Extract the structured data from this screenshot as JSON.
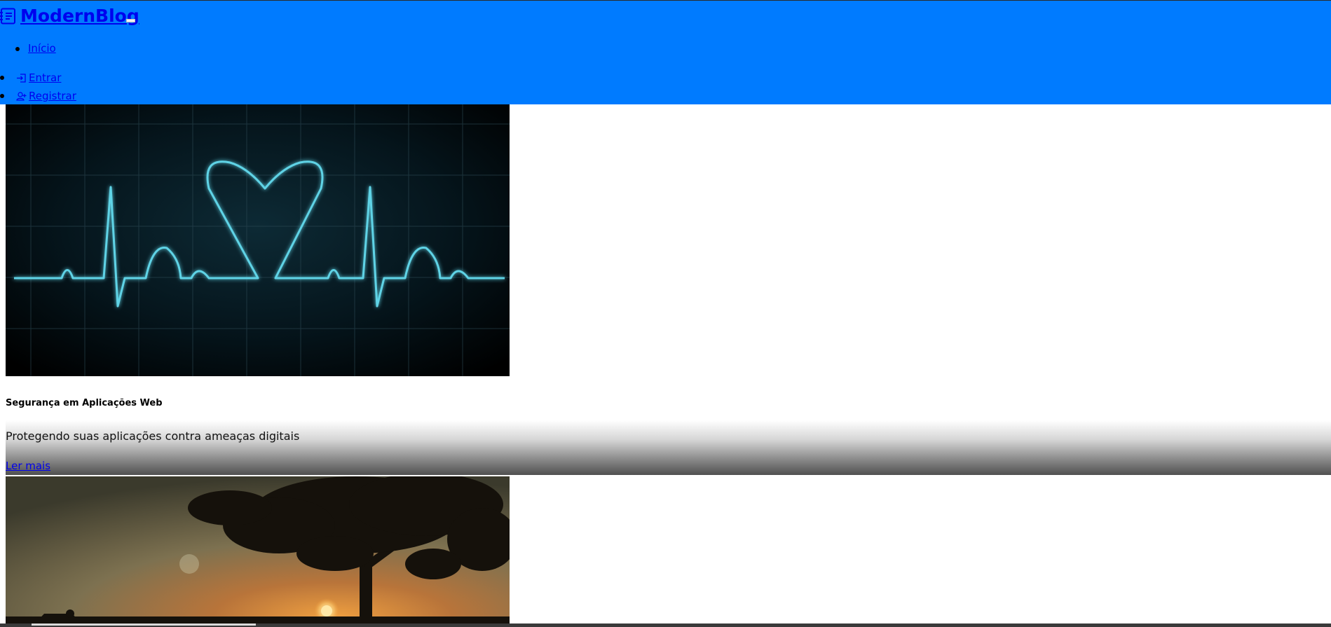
{
  "header": {
    "brand": "ModernBlog",
    "brand_icon": "journal-text-icon",
    "bg_color": "#007bff",
    "nav_items": [
      {
        "label": "Início",
        "icon": ""
      },
      {
        "label": "Entrar",
        "icon": "box-arrow-in-right-icon"
      },
      {
        "label": "Registrar",
        "icon": "person-plus-icon"
      }
    ]
  },
  "posts": [
    {
      "image": "ecg-heartbeat-heart-image",
      "title": "Segurança em Aplicações Web",
      "excerpt": "Protegendo suas aplicações contra ameaças digitais",
      "read_more": "Ler mais"
    },
    {
      "image": "sunset-tree-silhouette-image"
    }
  ]
}
